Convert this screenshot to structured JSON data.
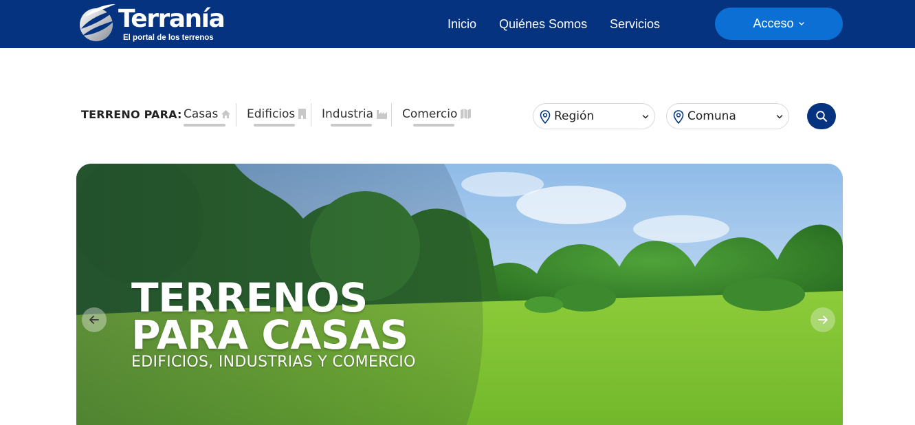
{
  "header": {
    "brand": "Terranía",
    "tagline": "El portal de los terrenos",
    "nav": [
      "Inicio",
      "Quiénes Somos",
      "Servicios"
    ],
    "access_label": "Acceso",
    "colors": {
      "bar": "#05337f",
      "access_button": "#0b6fd4"
    }
  },
  "search": {
    "label": "TERRENO PARA:",
    "types": [
      {
        "label": "Casas",
        "icon": "home-icon"
      },
      {
        "label": "Edificios",
        "icon": "building-icon"
      },
      {
        "label": "Industria",
        "icon": "factory-icon"
      },
      {
        "label": "Comercio",
        "icon": "map-icon"
      }
    ],
    "region_value": "Región",
    "comuna_value": "Comuna",
    "search_icon": "search-icon"
  },
  "hero": {
    "title_line1": "TERRENOS",
    "title_line2": "PARA CASAS",
    "subtitle": "EDIFICIOS, INDUSTRIAS Y COMERCIO",
    "prev_icon": "arrow-left-icon",
    "next_icon": "arrow-right-icon"
  }
}
